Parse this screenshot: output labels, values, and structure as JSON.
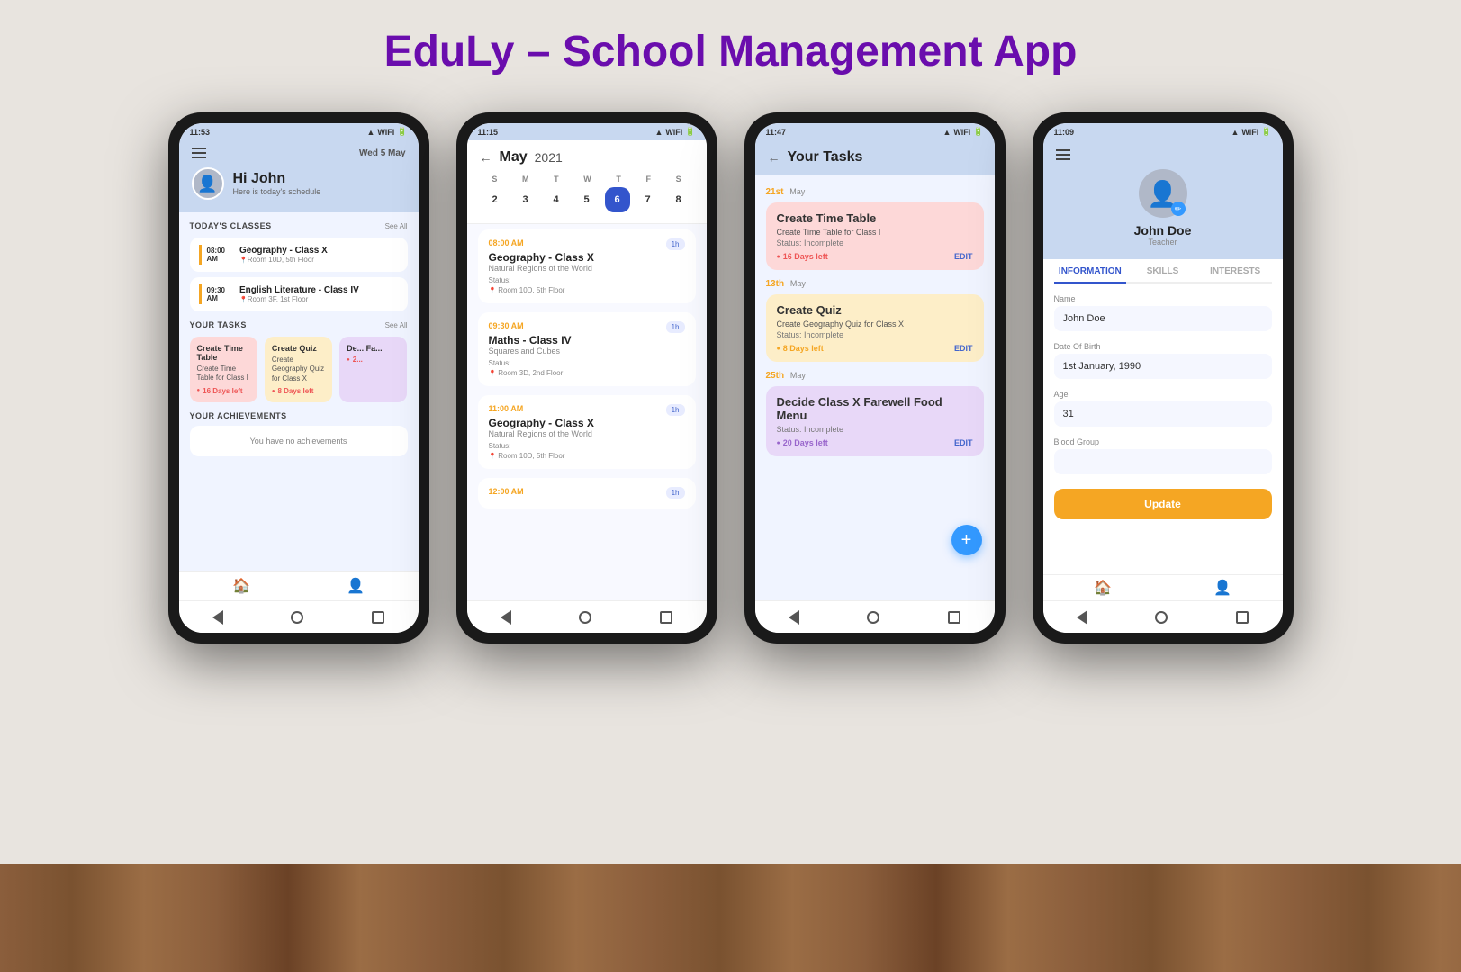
{
  "app": {
    "title": "EduLy – School Management App"
  },
  "phone1": {
    "status_time": "11:53",
    "date": "Wed 5 May",
    "greeting": "Hi John",
    "subtitle": "Here is today's schedule",
    "sections": {
      "classes_title": "TODAY'S CLASSES",
      "see_all": "See All",
      "tasks_title": "YOUR TASKS",
      "tasks_see_all": "See All",
      "achievements_title": "YOUR ACHIEVEMENTS",
      "no_achievements": "You have no achievements"
    },
    "classes": [
      {
        "time": "08:00",
        "period": "AM",
        "name": "Geography - Class X",
        "room": "Room 10D, 5th Floor"
      },
      {
        "time": "09:30",
        "period": "AM",
        "name": "English Literature - Class IV",
        "room": "Room 3F, 1st Floor"
      }
    ],
    "tasks": [
      {
        "title": "Create Time Table",
        "desc": "Create Time Table for Class I",
        "days": "16 Days left",
        "color": "pink"
      },
      {
        "title": "Create Quiz",
        "desc": "Create Geography Quiz for Class X",
        "days": "8 Days left",
        "color": "yellow"
      },
      {
        "title": "De... Fa...",
        "desc": "",
        "days": "2...",
        "color": "purple"
      }
    ]
  },
  "phone2": {
    "status_time": "11:15",
    "back_label": "←",
    "month": "May",
    "year": "2021",
    "calendar": {
      "day_labels": [
        "S",
        "M",
        "T",
        "W",
        "T",
        "F",
        "S"
      ],
      "days": [
        "2",
        "3",
        "4",
        "5",
        "6",
        "7",
        "8"
      ],
      "active_day": "6"
    },
    "schedule": [
      {
        "time": "08:00 AM",
        "duration": "1h",
        "title": "Geography - Class X",
        "subtitle": "Natural Regions of the World",
        "status": "Status:",
        "room": "Room 10D, 5th Floor"
      },
      {
        "time": "09:30 AM",
        "duration": "1h",
        "title": "Maths - Class IV",
        "subtitle": "Squares and Cubes",
        "status": "Status:",
        "room": "Room 3D, 2nd Floor"
      },
      {
        "time": "11:00 AM",
        "duration": "1h",
        "title": "Geography - Class X",
        "subtitle": "Natural Regions of the World",
        "status": "Status:",
        "room": "Room 10D, 5th Floor"
      },
      {
        "time": "12:00 AM",
        "duration": "1h",
        "title": "",
        "subtitle": "",
        "status": "",
        "room": ""
      }
    ]
  },
  "phone3": {
    "status_time": "11:47",
    "back_label": "←",
    "page_title": "Your Tasks",
    "dates": [
      {
        "date": "21st",
        "month": "May"
      },
      {
        "date": "13th",
        "month": "May"
      },
      {
        "date": "25th",
        "month": "May"
      },
      {
        "date": "25th",
        "month": "May"
      }
    ],
    "tasks": [
      {
        "title": "Create Time Table",
        "desc": "Create Time Table for Class I",
        "status": "Status: Incomplete",
        "days": "16 Days left",
        "days_color": "red",
        "color": "pink",
        "edit": "EDIT"
      },
      {
        "title": "Create Quiz",
        "desc": "Create Geography Quiz for Class X",
        "status": "Status: Incomplete",
        "days": "8 Days left",
        "days_color": "orange",
        "color": "yellow",
        "edit": "EDIT"
      },
      {
        "title": "Decide Class X Farewell Food Menu",
        "desc": "",
        "status": "Status: Incomplete",
        "days": "20 Days left",
        "days_color": "purple-c",
        "color": "purple",
        "edit": "EDIT"
      }
    ],
    "fab_label": "+"
  },
  "phone4": {
    "status_time": "11:09",
    "profile_name": "John Doe",
    "profile_role": "Teacher",
    "tabs": [
      "INFORMATION",
      "SKILLS",
      "INTERESTS"
    ],
    "active_tab": "INFORMATION",
    "fields": [
      {
        "label": "Name",
        "value": "John Doe"
      },
      {
        "label": "Date Of Birth",
        "value": "1st January, 1990"
      },
      {
        "label": "Age",
        "value": "31"
      },
      {
        "label": "Blood Group",
        "value": ""
      }
    ],
    "update_btn": "Update"
  }
}
